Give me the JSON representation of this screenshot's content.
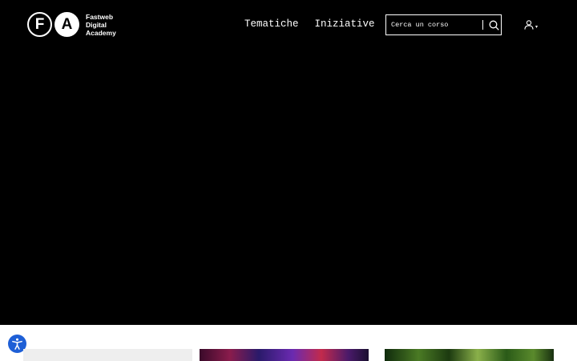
{
  "header": {
    "logo_letter_1": "F",
    "logo_letter_2": "A",
    "brand_name": "Fastweb Digital Academy",
    "nav": [
      "Tematiche",
      "Iniziative"
    ],
    "search": {
      "placeholder": "Cerca un corso",
      "value": ""
    },
    "icons": {
      "search": "search-icon",
      "user": "user-icon",
      "caret": "caret-down-icon"
    }
  },
  "accessibility": {
    "icon": "accessibility-icon",
    "color": "#1e5fd6"
  },
  "cards": [
    {
      "type": "image",
      "theme": "light-gray"
    },
    {
      "type": "image",
      "theme": "purple-red-neon"
    },
    {
      "type": "image",
      "theme": "green-sparks"
    }
  ],
  "colors": {
    "hero_bg": "#000000",
    "page_bg": "#ffffff",
    "text_on_dark": "#ffffff"
  }
}
